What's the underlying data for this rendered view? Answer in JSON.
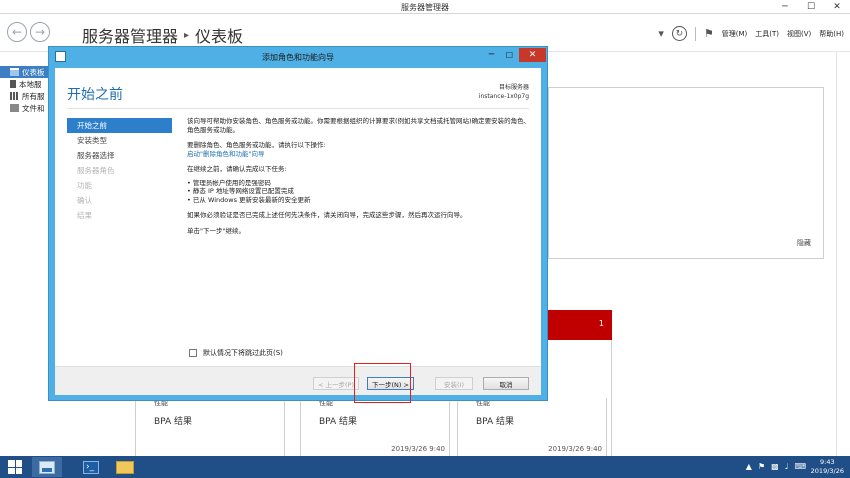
{
  "window": {
    "title": "服务器管理器",
    "min": "─",
    "max": "☐",
    "close": "✕"
  },
  "header": {
    "breadcrumb_root": "服务器管理器",
    "breadcrumb_sep": "▸",
    "breadcrumb_current": "仪表板",
    "menus": {
      "manage": "管理(M)",
      "tools": "工具(T)",
      "view": "视图(V)",
      "help": "帮助(H)"
    }
  },
  "sidebar": {
    "items": [
      {
        "label": "仪表板"
      },
      {
        "label": "本地服"
      },
      {
        "label": "所有服"
      },
      {
        "label": "文件和"
      }
    ]
  },
  "background": {
    "hide_label": "隐藏",
    "red_tile_count": "1",
    "tiles": [
      {
        "perf": "性能",
        "bpa": "BPA 结果",
        "timestamp": ""
      },
      {
        "perf": "性能",
        "bpa": "BPA 结果",
        "timestamp": "2019/3/26 9:40"
      },
      {
        "perf": "性能",
        "bpa": "BPA 结果",
        "timestamp": "2019/3/26 9:40"
      }
    ]
  },
  "dialog": {
    "title": "添加角色和功能向导",
    "heading": "开始之前",
    "destination_label": "目标服务器",
    "destination_value": "instance-1x0p7g",
    "steps": [
      {
        "label": "开始之前",
        "state": "active"
      },
      {
        "label": "安装类型",
        "state": "normal"
      },
      {
        "label": "服务器选择",
        "state": "normal"
      },
      {
        "label": "服务器角色",
        "state": "disabled"
      },
      {
        "label": "功能",
        "state": "disabled"
      },
      {
        "label": "确认",
        "state": "disabled"
      },
      {
        "label": "结果",
        "state": "disabled"
      }
    ],
    "paragraph1": "该向导可帮助你安装角色、角色服务或功能。你需要根据组织的计算要求(例如共享文档或托管网站)确定要安装的角色、角色服务或功能。",
    "paragraph2": "要删除角色、角色服务或功能，请执行以下操作:",
    "remove_link": "启动\"删除角色和功能\"向导",
    "paragraph3": "在继续之前，请确认完成以下任务:",
    "bullets": [
      "• 管理员帐户使用的是强密码",
      "• 静态 IP 地址等网络设置已配置完成",
      "• 已从 Windows 更新安装最新的安全更新"
    ],
    "paragraph4": "如果你必须验证是否已完成上述任何先决条件，请关闭向导，完成这些步骤，然后再次运行向导。",
    "paragraph5": "单击\"下一步\"继续。",
    "skip_label": "默认情况下将跳过此页(S)",
    "buttons": {
      "prev": "< 上一步(P)",
      "next": "下一步(N) >",
      "install": "安装(I)",
      "cancel": "取消"
    }
  },
  "taskbar": {
    "clock_time": "9:43",
    "clock_date": "2019/3/26"
  }
}
